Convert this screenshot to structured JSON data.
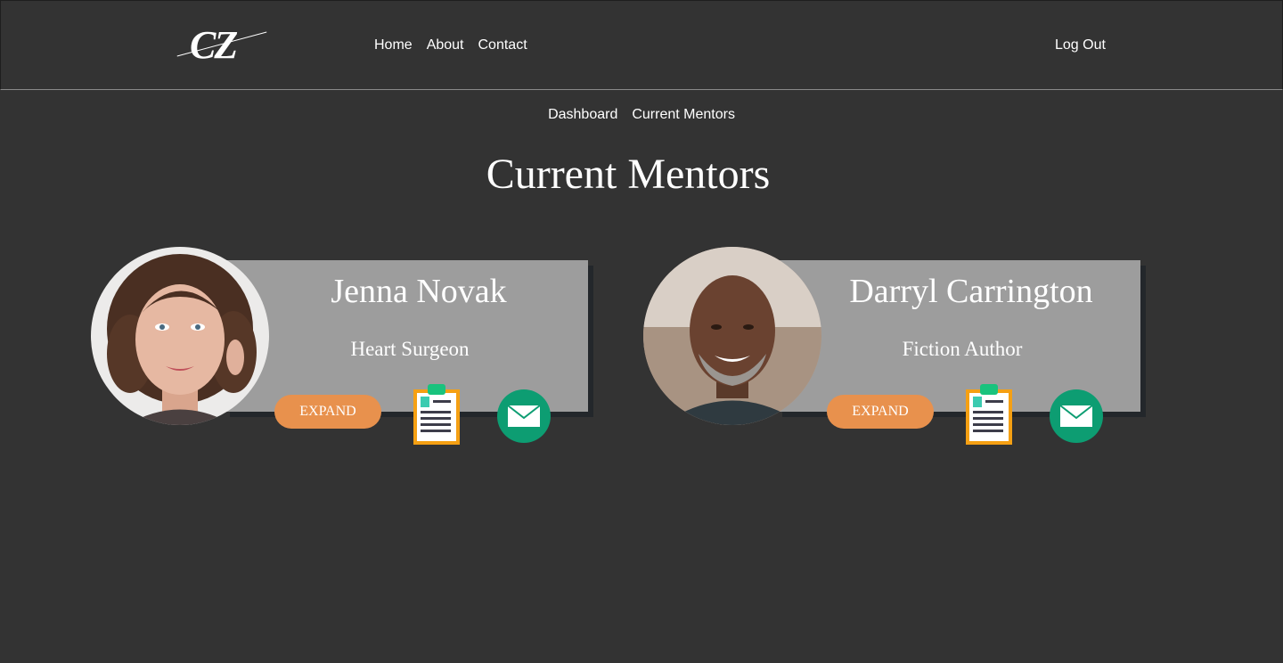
{
  "header": {
    "logo_text": "CZ",
    "nav": [
      "Home",
      "About",
      "Contact"
    ],
    "logout_label": "Log Out"
  },
  "breadcrumb": [
    "Dashboard",
    "Current Mentors"
  ],
  "page": {
    "title": "Current Mentors"
  },
  "colors": {
    "background": "#333333",
    "card": "#9d9d9d",
    "card_shadow": "#23272b",
    "expand_button": "#e8914d",
    "mail_icon": "#0d9d72",
    "resume_border": "#f5a013",
    "resume_clip": "#19c37d"
  },
  "mentors": [
    {
      "name": "Jenna Novak",
      "role": "Heart Surgeon",
      "expand_label": "EXPAND",
      "icons": [
        "resume-icon",
        "mail-icon"
      ]
    },
    {
      "name": "Darryl Carrington",
      "role": "Fiction Author",
      "expand_label": "EXPAND",
      "icons": [
        "resume-icon",
        "mail-icon"
      ]
    }
  ]
}
